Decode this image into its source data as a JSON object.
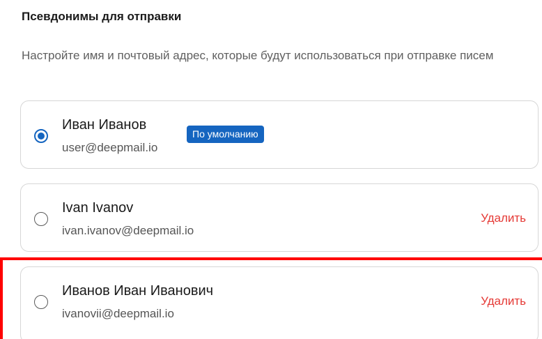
{
  "section": {
    "title": "Псевдонимы для отправки",
    "description": "Настройте имя и почтовый адрес, которые будут использоваться при отправке писем"
  },
  "aliases": [
    {
      "name": "Иван Иванов",
      "email": "user@deepmail.io",
      "selected": true,
      "badge": "По умолчанию"
    },
    {
      "name": "Ivan Ivanov",
      "email": "ivan.ivanov@deepmail.io",
      "selected": false,
      "delete_label": "Удалить"
    },
    {
      "name": "Иванов Иван Иванович",
      "email": "ivanovii@deepmail.io",
      "selected": false,
      "delete_label": "Удалить"
    }
  ],
  "colors": {
    "accent": "#1565c0",
    "danger": "#e53935",
    "highlight": "#ff0000",
    "border": "#d6d6d6"
  }
}
